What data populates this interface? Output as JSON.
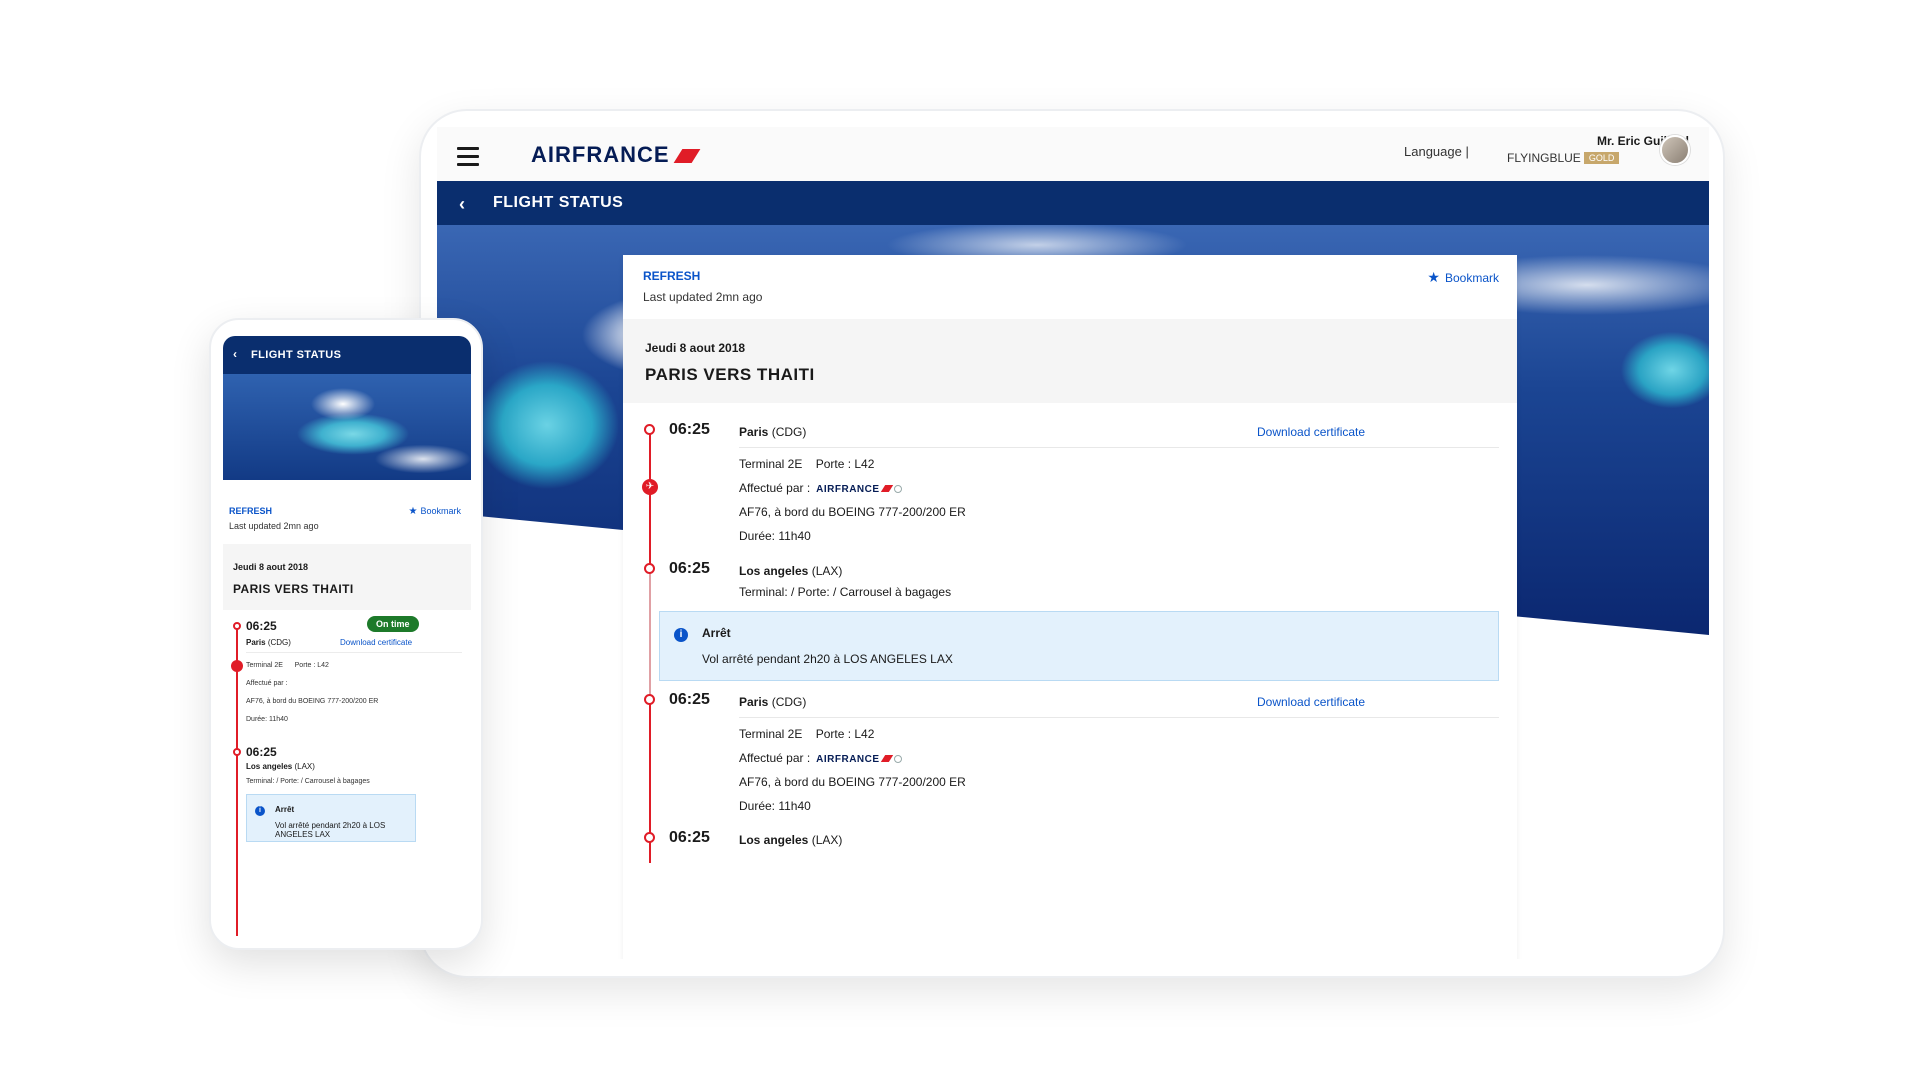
{
  "header": {
    "logo": "AIRFRANCE",
    "language_label": "Language |",
    "user_name": "Mr. Eric Guillard",
    "loyalty_program": "FLYINGBLUE",
    "loyalty_tier": "GOLD"
  },
  "nav": {
    "back_icon": "chevron-left-icon",
    "title": "FLIGHT STATUS"
  },
  "status": {
    "refresh_label": "REFRESH",
    "last_updated": "Last updated 2mn ago",
    "bookmark_label": "Bookmark"
  },
  "trip": {
    "date": "Jeudi 8 aout 2018",
    "route": "PARIS VERS THAITI"
  },
  "segments": [
    {
      "time": "06:25",
      "city": "Paris",
      "code": "(CDG)",
      "download_label": "Download certificate",
      "terminal": "Terminal 2E",
      "gate": "Porte :  L42",
      "operated_by_label": "Affectué par :",
      "operator_logo": "AIRFRANCE",
      "flight": "AF76, à bord du BOEING 777-200/200 ER",
      "duration": "Durée: 11h40"
    },
    {
      "time": "06:25",
      "city": "Los angeles",
      "code": "(LAX)",
      "details": "Terminal:  / Porte:  / Carrousel à bagages"
    },
    {
      "time": "06:25",
      "city": "Paris",
      "code": "(CDG)",
      "download_label": "Download certificate",
      "terminal": "Terminal 2E",
      "gate": "Porte :  L42",
      "operated_by_label": "Affectué par :",
      "operator_logo": "AIRFRANCE",
      "flight": "AF76, à bord du BOEING 777-200/200 ER",
      "duration": "Durée: 11h40"
    },
    {
      "time": "06:25",
      "city": "Los angeles",
      "code": "(LAX)"
    }
  ],
  "stopover": {
    "title": "Arrêt",
    "description": "Vol arrêté pendant 2h20 à LOS ANGELES LAX",
    "mobile_description": "Vol arrêté pendant 2h20 à LOS ANGELES LAX"
  },
  "mobile": {
    "status_badge": "On time",
    "terminal": "Terminal 2E",
    "gate": "Porte :  L42",
    "operated_by_label": "Affectué par :",
    "flight": "AF76, à bord du BOEING 777-200/200 ER",
    "duration": "Durée: 11h40",
    "details": "Terminal:  / Porte:  / Carrousel à bagages"
  },
  "colors": {
    "navy": "#0a2e6e",
    "link_blue": "#0a54c9",
    "af_red": "#e01c27",
    "on_time_green": "#1d7a2a",
    "gold": "#c7a76b",
    "stop_bg": "#e3f1fc"
  }
}
